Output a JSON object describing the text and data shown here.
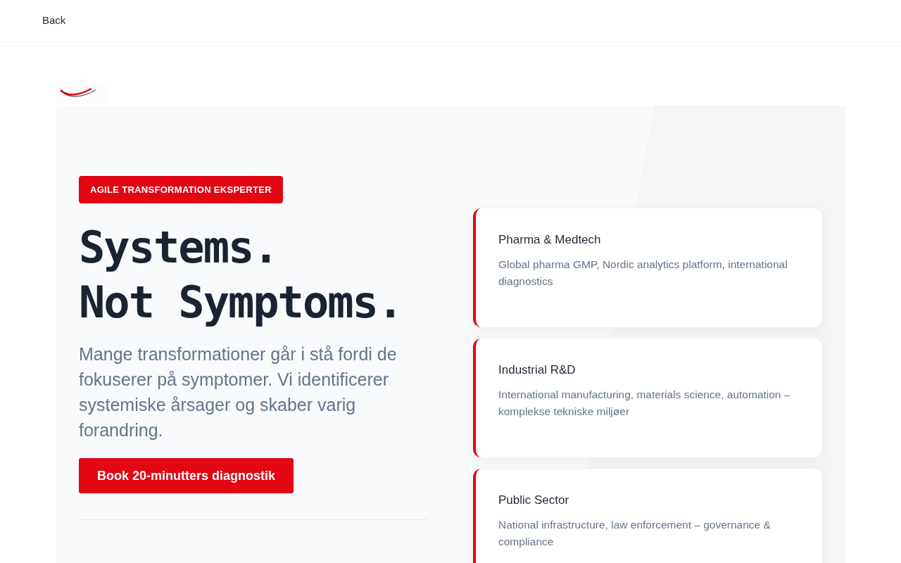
{
  "header": {
    "back_link": "Back"
  },
  "hero": {
    "badge": "AGILE TRANSFORMATION EKSPERTER",
    "title_lines": [
      "Systems.",
      "Not Symptoms."
    ],
    "lead": "Mange transformationer går i stå fordi de fokuserer på symptomer. Vi identificerer systemiske årsager og skaber varig forandring.",
    "cta": "Book 20-minutters diagnostik"
  },
  "sectors": [
    {
      "title": "Pharma & Medtech",
      "description": "Global pharma GMP, Nordic analytics platform, international diagnostics"
    },
    {
      "title": "Industrial R&D",
      "description": "International manufacturing, materials science, automation – komplekse tekniske miljøer"
    },
    {
      "title": "Public Sector",
      "description": "National infrastructure, law enforcement – governance & compliance"
    }
  ]
}
